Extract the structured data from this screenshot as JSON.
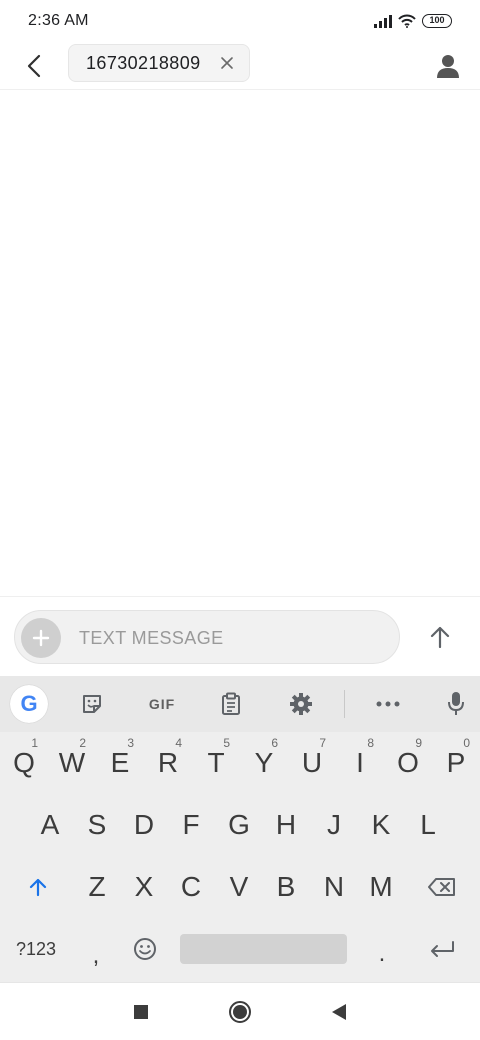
{
  "status_bar": {
    "time": "2:36 AM",
    "battery": "100",
    "icons": [
      "signal-icon",
      "wifi-icon",
      "battery-icon"
    ]
  },
  "header": {
    "recipient": "16730218809",
    "icons": [
      "back-arrow-icon",
      "close-icon",
      "contact-icon"
    ]
  },
  "compose": {
    "placeholder": "Text message",
    "icons": [
      "plus-icon",
      "send-arrow-icon"
    ]
  },
  "keyboard": {
    "toolbar": {
      "gif_label": "GIF",
      "icons": [
        "google-icon",
        "sticker-icon",
        "clipboard-icon",
        "gear-icon",
        "more-icon",
        "mic-icon"
      ]
    },
    "row1": [
      {
        "key": "Q",
        "hint": "1"
      },
      {
        "key": "W",
        "hint": "2"
      },
      {
        "key": "E",
        "hint": "3"
      },
      {
        "key": "R",
        "hint": "4"
      },
      {
        "key": "T",
        "hint": "5"
      },
      {
        "key": "Y",
        "hint": "6"
      },
      {
        "key": "U",
        "hint": "7"
      },
      {
        "key": "I",
        "hint": "8"
      },
      {
        "key": "O",
        "hint": "9"
      },
      {
        "key": "P",
        "hint": "0"
      }
    ],
    "row2": [
      "A",
      "S",
      "D",
      "F",
      "G",
      "H",
      "J",
      "K",
      "L"
    ],
    "row3": [
      "Z",
      "X",
      "C",
      "V",
      "B",
      "N",
      "M"
    ],
    "row4": {
      "symbols": "?123",
      "comma": ",",
      "period": "."
    },
    "icons": [
      "shift-icon",
      "backspace-icon",
      "emoji-icon",
      "enter-icon"
    ]
  },
  "nav_bar": {
    "icons": [
      "recents-square-icon",
      "home-circle-icon",
      "back-triangle-icon"
    ]
  },
  "colors": {
    "accent": "#1a73e8",
    "keyboard_bg": "#eeeeee",
    "toolbar_bg": "#e8e8e8",
    "key_text": "#3c3c3c"
  }
}
